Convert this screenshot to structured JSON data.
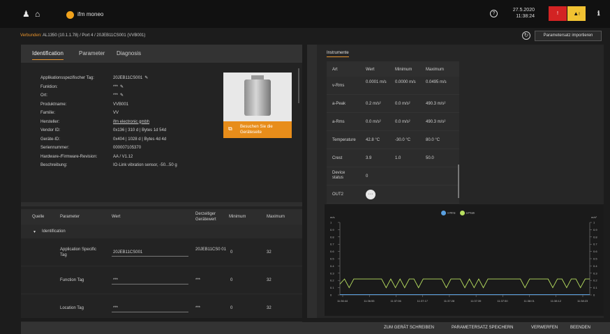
{
  "topbar": {
    "user_icon": "user-icon",
    "home_icon": "home-icon",
    "app_name": "ifm moneo",
    "help_icon": "help-icon",
    "date": "27.5.2020",
    "time": "11:38:24",
    "alarm_red_label": "!",
    "alarm_yellow_label": "!",
    "info_icon": "info-icon",
    "accent": "#e8932c"
  },
  "connection": {
    "label": "Verbunden:",
    "path": "AL1350 (10.1.1.78) / Port 4 / 20JEB11CS001 (VVB001)",
    "import_button": "Parametersatz importieren"
  },
  "left": {
    "tabs": [
      "Identification",
      "Parameter",
      "Diagnosis"
    ],
    "properties": [
      {
        "key": "Applikationsspezifischer Tag:",
        "value": "20JEB11CS001"
      },
      {
        "key": "Funktion:",
        "value": "***"
      },
      {
        "key": "Ort:",
        "value": "***"
      },
      {
        "key": "Produktname:",
        "value": "VVB001"
      },
      {
        "key": "Familie:",
        "value": "VV"
      },
      {
        "key": "Hersteller:",
        "value": "ifm electronic gmbh"
      },
      {
        "key": "Vendor ID:",
        "value": "0x136 | 310 d | Bytes 1d 54d"
      },
      {
        "key": "Geräte-ID:",
        "value": "0x404 | 1028 d | Bytes 4d 4d"
      },
      {
        "key": "Seriennummer:",
        "value": "000007105370"
      },
      {
        "key": "Hardware-/Firmware-Revision:",
        "value": "AA / V1.12"
      },
      {
        "key": "Beschreibung:",
        "value": "IO-Link vibration sensor, -50...50 g"
      }
    ],
    "image_caption": "Besuchen Sie die Geräteseite",
    "param_table": {
      "headers": [
        "Quelle",
        "Parameter",
        "Wert",
        "Derzeitiger Gerätewert",
        "Minimum",
        "Maximum"
      ],
      "group": "Identification",
      "rows": [
        {
          "parameter": "Application Specific Tag",
          "value": "20JEB11CS001",
          "device_value": "20JEB11CS0 01",
          "min": "0",
          "max": "32"
        },
        {
          "parameter": "Function Tag",
          "value": "***",
          "device_value": "***",
          "min": "0",
          "max": "32"
        },
        {
          "parameter": "Location Tag",
          "value": "***",
          "device_value": "***",
          "min": "0",
          "max": "32"
        }
      ]
    }
  },
  "right": {
    "title": "Instrumente",
    "table": {
      "headers": [
        "Art",
        "Wert",
        "Minimum",
        "Maximum"
      ],
      "rows": [
        {
          "art": "v-Rms",
          "wert": "0.0001 m/s",
          "min": "0.0000 m/s",
          "max": "0.0495 m/s"
        },
        {
          "art": "a-Peak",
          "wert": "0.2 m/s²",
          "min": "0.0 m/s²",
          "max": "490.3 m/s²"
        },
        {
          "art": "a-Rms",
          "wert": "0.0 m/s²",
          "min": "0.0 m/s²",
          "max": "490.3 m/s²"
        },
        {
          "art": "Temperature",
          "wert": "42.8 °C",
          "min": "-30.0 °C",
          "max": "80.0 °C"
        },
        {
          "art": "Crest",
          "wert": "3.9",
          "min": "1.0",
          "max": "50.0"
        },
        {
          "art": "Device status",
          "wert": "0",
          "min": "",
          "max": ""
        },
        {
          "art": "OUT2",
          "wert": "",
          "min": "",
          "max": ""
        }
      ]
    }
  },
  "chart_data": {
    "type": "line",
    "legend": [
      "v-Rms",
      "a-Peak"
    ],
    "legend_colors": [
      "#5aa0e0",
      "#b8e060"
    ],
    "y_left_unit": "m/s",
    "y_right_unit": "m/s²",
    "ylim": [
      0,
      1
    ],
    "yticks": [
      "0",
      "0.1",
      "0.2",
      "0.3",
      "0.4",
      "0.5",
      "0.6",
      "0.7",
      "0.8",
      "0.9",
      "1"
    ],
    "x": [
      "11:36:44",
      "11:36:55",
      "11:37:06",
      "11:37:17",
      "11:37:28",
      "11:37:39",
      "11:37:50",
      "11:38:01",
      "11:38:12",
      "11:38:23"
    ],
    "series": [
      {
        "name": "a-Peak",
        "values": [
          0.15,
          0.22,
          0.1,
          0.22,
          0.22,
          0.22,
          0.22,
          0.22,
          0.22,
          0.22,
          0.1,
          0.22,
          0.1,
          0.22,
          0.1,
          0.22,
          0.22,
          0.1,
          0.22,
          0.22,
          0.22,
          0.22,
          0.22,
          0.1,
          0.22,
          0.22,
          0.22,
          0.1,
          0.22,
          0.1,
          0.22,
          0.1,
          0.22,
          0.22,
          0.22,
          0.22,
          0.22,
          0.22,
          0.22,
          0.22,
          0.1,
          0.22,
          0.22,
          0.22,
          0.22,
          0.22,
          0.1,
          0.22,
          0.22,
          0.1,
          0.22,
          0.22,
          0.1,
          0.22,
          0.22
        ]
      },
      {
        "name": "v-Rms",
        "values": [
          0.005,
          0.005,
          0.005,
          0.005,
          0.005,
          0.005,
          0.005,
          0.005,
          0.005,
          0.005,
          0.005,
          0.005,
          0.005,
          0.005,
          0.005,
          0.005,
          0.005,
          0.005,
          0.005,
          0.005,
          0.005,
          0.005,
          0.005,
          0.005,
          0.005,
          0.005,
          0.005,
          0.005,
          0.005,
          0.005,
          0.005,
          0.005,
          0.005,
          0.005,
          0.005,
          0.005,
          0.005,
          0.005,
          0.005,
          0.005,
          0.005,
          0.005,
          0.005,
          0.005,
          0.005,
          0.005,
          0.005,
          0.005,
          0.005,
          0.005,
          0.005,
          0.005,
          0.005,
          0.005,
          0.005
        ]
      }
    ]
  },
  "bottom": {
    "buttons": [
      "ZUM GERÄT SCHREIBEN",
      "PARAMETERSATZ SPEICHERN",
      "VERWERFEN",
      "BEENDEN"
    ]
  }
}
